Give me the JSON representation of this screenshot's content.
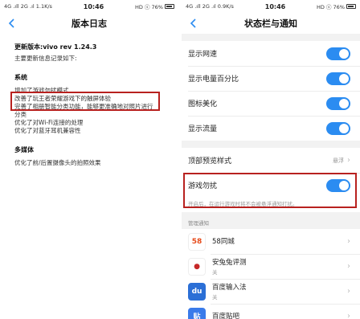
{
  "left": {
    "statusbar": {
      "signal": "4G .ıll 2G .ıl 1.1K/s",
      "time": "10:46",
      "right": "HD ⓢ 76%"
    },
    "title": "版本日志",
    "version": "更新版本:vivo rev 1.24.3",
    "intro": "主要更新信息记录如下:",
    "sections": [
      {
        "heading": "系统",
        "lines": [
          "增加了游戏勿扰模式",
          "改善了玩王者荣耀游戏下的触屏体验",
          "完善了相册智能分类功能，能够更准确地对照片进行",
          "分类",
          "优化了对Wi-Fi连接的处理",
          "优化了对蓝牙耳机兼容性"
        ]
      },
      {
        "heading": "多媒体",
        "lines": [
          "优化了前/后置摄像头的拍照效果"
        ]
      }
    ]
  },
  "right": {
    "statusbar": {
      "signal": "4G .ıll 2G .ıl 0.9K/s",
      "time": "10:46",
      "right": "HD ⓢ 76%"
    },
    "title": "状态栏与通知",
    "toggles": [
      "显示网速",
      "显示电量百分比",
      "图标美化",
      "显示流量"
    ],
    "top_preview": {
      "label": "顶部预览样式",
      "value": "悬浮"
    },
    "game": {
      "label": "游戏勿扰",
      "hint": "开启后，在运行游戏时将不会被悬浮通知打扰。"
    },
    "manage_label": "管理通知",
    "apps": [
      {
        "name": "58同城",
        "status": "",
        "icon_text": "58",
        "icon_bg": "#ffffff",
        "icon_color": "#e64a19"
      },
      {
        "name": "安兔兔评测",
        "status": "关",
        "icon_text": "●",
        "icon_bg": "#ffffff",
        "icon_color": "#c62828"
      },
      {
        "name": "百度输入法",
        "status": "关",
        "icon_text": "du",
        "icon_bg": "#2b6fd6",
        "icon_color": "#ffffff"
      },
      {
        "name": "百度贴吧",
        "status": "",
        "icon_text": "贴",
        "icon_bg": "#3a7bea",
        "icon_color": "#ffffff"
      }
    ]
  },
  "colors": {
    "accent": "#2b8cf1",
    "highlight": "#b8211f"
  }
}
